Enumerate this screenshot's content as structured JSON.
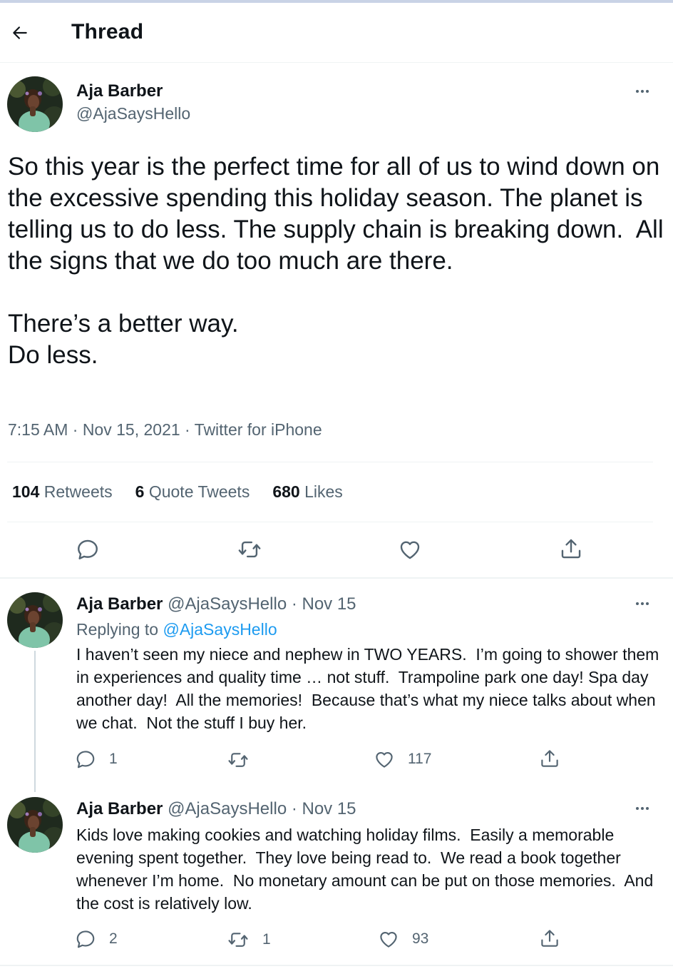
{
  "header": {
    "title": "Thread"
  },
  "main_tweet": {
    "author_name": "Aja Barber",
    "author_handle": "@AjaSaysHello",
    "text": "So this year is the perfect time for all of us to wind down on the excessive spending this holiday season. The planet is telling us to do less. The supply chain is breaking down.  All the signs that we do too much are there.\n\nThere’s a better way.\nDo less.",
    "meta": "7:15 AM · Nov 15, 2021 · Twitter for iPhone",
    "stats": {
      "retweets_count": "104",
      "retweets_label": "Retweets",
      "quotes_count": "6",
      "quotes_label": "Quote Tweets",
      "likes_count": "680",
      "likes_label": "Likes"
    }
  },
  "replies": [
    {
      "author_name": "Aja Barber",
      "author_handle": "@AjaSaysHello · Nov 15",
      "replying_prefix": "Replying to",
      "replying_to": "@AjaSaysHello",
      "text": "I haven’t seen my niece and nephew in TWO YEARS.  I’m going to shower them in experiences and quality time … not stuff.  Trampoline park one day! Spa day another day!  All the memories!  Because that’s what my niece talks about when we chat.  Not the stuff I buy her.",
      "reply_count": "1",
      "retweet_count": "",
      "like_count": "117"
    },
    {
      "author_name": "Aja Barber",
      "author_handle": "@AjaSaysHello · Nov 15",
      "text": "Kids love making cookies and watching holiday films.  Easily a memorable evening spent together.  They love being read to.  We read a book together whenever I’m home.  No monetary amount can be put on those memories.  And the cost is relatively low.",
      "reply_count": "2",
      "retweet_count": "1",
      "like_count": "93"
    }
  ],
  "icons": {
    "back": "back-arrow-icon",
    "more": "more-dots-icon",
    "reply": "reply-bubble-icon",
    "retweet": "retweet-icon",
    "like": "heart-icon",
    "share": "share-icon"
  },
  "colors": {
    "text_primary": "#0f1419",
    "text_secondary": "#536471",
    "link": "#1d9bf0",
    "divider": "#eff3f4"
  }
}
